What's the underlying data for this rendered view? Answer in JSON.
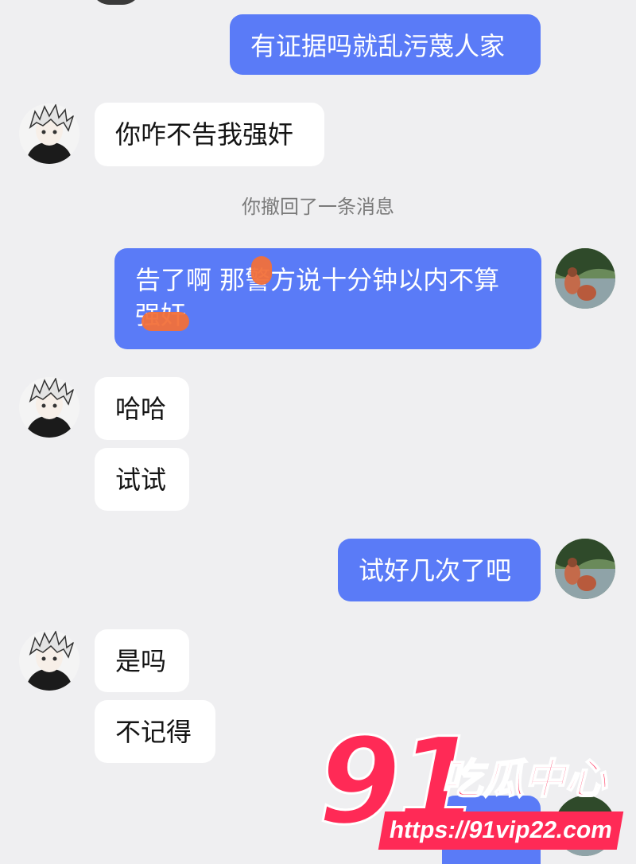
{
  "messages": [
    {
      "side": "me",
      "text": "有证据吗就乱污蔑人家"
    },
    {
      "side": "them",
      "text": "你咋不告我强奸"
    },
    {
      "side": "system",
      "text": "你撤回了一条消息"
    },
    {
      "side": "me",
      "text": "告了啊 那警方说十分钟以内不算强奸"
    },
    {
      "side": "them",
      "text": "哈哈"
    },
    {
      "side": "them",
      "text": "试试"
    },
    {
      "side": "me",
      "text": "试好几次了吧"
    },
    {
      "side": "them",
      "text": "是吗"
    },
    {
      "side": "them",
      "text": "不记得"
    }
  ],
  "watermark": {
    "number": "91",
    "brand": "吃瓜中心",
    "url": "https://91vip22.com"
  },
  "colors": {
    "background": "#efeff1",
    "my_bubble": "#5a7bf7",
    "their_bubble": "#ffffff",
    "watermark": "#ff2a56"
  }
}
